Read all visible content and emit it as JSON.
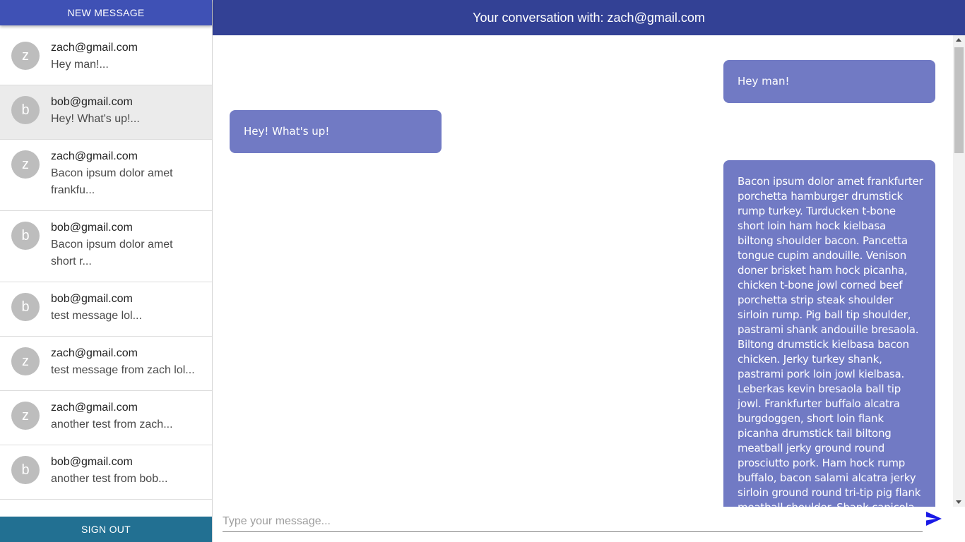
{
  "sidebar": {
    "new_message_label": "NEW MESSAGE",
    "sign_out_label": "SIGN OUT",
    "chats": [
      {
        "initial": "z",
        "email": "zach@gmail.com",
        "preview": "Hey man!..."
      },
      {
        "initial": "b",
        "email": "bob@gmail.com",
        "preview": "Hey! What's up!...",
        "selected": true
      },
      {
        "initial": "z",
        "email": "zach@gmail.com",
        "preview": "Bacon ipsum dolor amet frankfu..."
      },
      {
        "initial": "b",
        "email": "bob@gmail.com",
        "preview": "Bacon ipsum dolor amet short r..."
      },
      {
        "initial": "b",
        "email": "bob@gmail.com",
        "preview": "test message lol..."
      },
      {
        "initial": "z",
        "email": "zach@gmail.com",
        "preview": "test message from zach lol..."
      },
      {
        "initial": "z",
        "email": "zach@gmail.com",
        "preview": "another test from zach..."
      },
      {
        "initial": "b",
        "email": "bob@gmail.com",
        "preview": "another test from bob..."
      }
    ]
  },
  "header": {
    "title": "Your conversation with: zach@gmail.com"
  },
  "messages": [
    {
      "side": "right",
      "text": "Hey man!"
    },
    {
      "side": "left",
      "text": "Hey! What's up!"
    },
    {
      "side": "right",
      "text": "Bacon ipsum dolor amet frankfurter porchetta hamburger drumstick rump turkey. Turducken t-bone short loin ham hock kielbasa biltong shoulder bacon. Pancetta tongue cupim andouille. Venison doner brisket ham hock picanha, chicken t-bone jowl corned beef porchetta strip steak shoulder sirloin rump. Pig ball tip shoulder, pastrami shank andouille bresaola. Biltong drumstick kielbasa bacon chicken. Jerky turkey shank, pastrami pork loin jowl kielbasa. Leberkas kevin bresaola ball tip jowl. Frankfurter buffalo alcatra burgdoggen, short loin flank picanha drumstick tail biltong meatball jerky ground round prosciutto pork. Ham hock rump buffalo, bacon salami alcatra jerky sirloin ground round tri-tip pig flank meatball shoulder. Shank capicola turkey, porchetta ham pig beef tenderloin."
    }
  ],
  "composer": {
    "placeholder": "Type your message..."
  },
  "colors": {
    "primary": "#3f51b5",
    "header": "#334195",
    "bubble": "#717ac4",
    "sign_out": "#227092",
    "send_icon": "#1a1ae6"
  }
}
